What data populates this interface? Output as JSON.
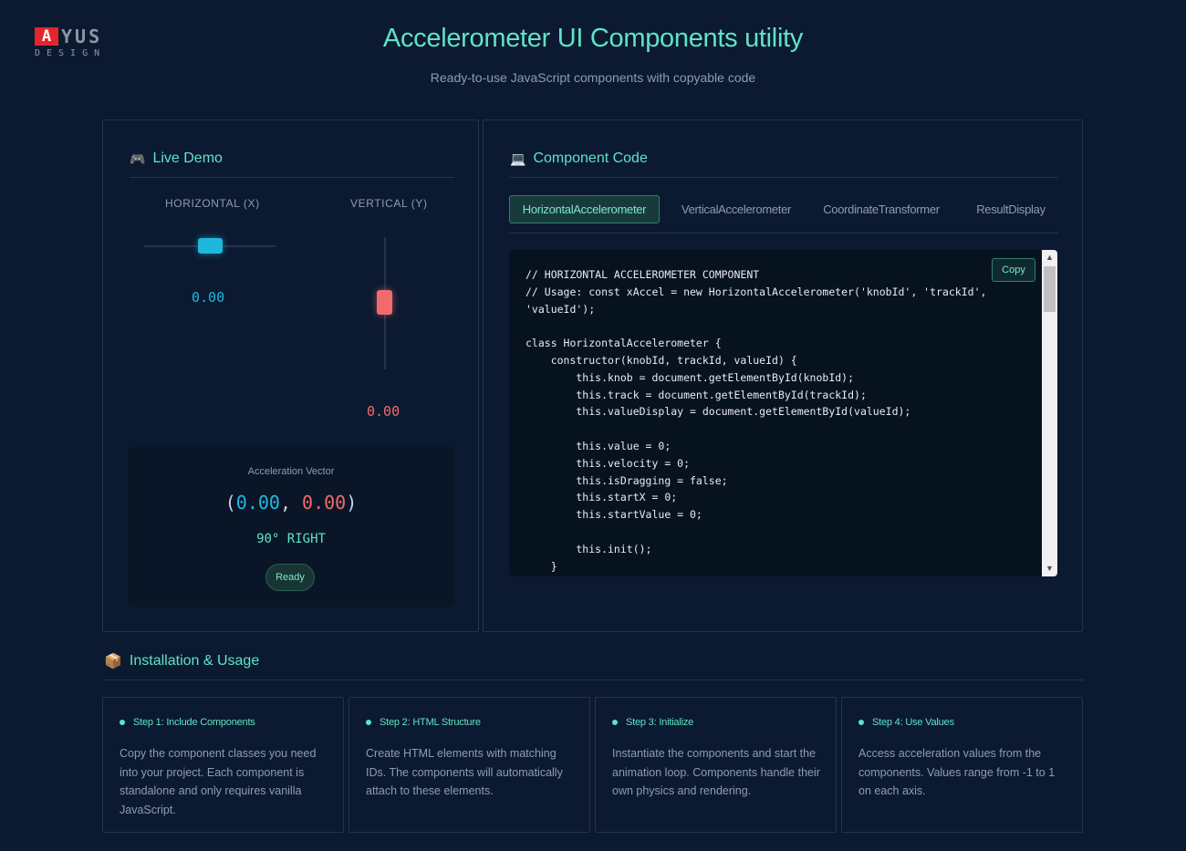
{
  "logo": {
    "mark": "A",
    "rest": "YUS",
    "sub": "DESIGN"
  },
  "header": {
    "title": "Accelerometer UI Components utility",
    "subtitle": "Ready-to-use JavaScript components with copyable code"
  },
  "demo": {
    "icon": "🎮",
    "heading": "Live Demo",
    "horizontal_label": "HORIZONTAL (X)",
    "vertical_label": "VERTICAL (Y)",
    "x_value": "0.00",
    "y_value": "0.00",
    "vector_label": "Acceleration Vector",
    "vector_open": "(",
    "vector_x": "0.00",
    "vector_sep": ", ",
    "vector_y": "0.00",
    "vector_close": ")",
    "direction": "90° RIGHT",
    "status": "Ready"
  },
  "code": {
    "icon": "💻",
    "heading": "Component Code",
    "tabs": [
      {
        "label": "HorizontalAccelerometer",
        "active": true
      },
      {
        "label": "VerticalAccelerometer",
        "active": false
      },
      {
        "label": "CoordinateTransformer",
        "active": false
      },
      {
        "label": "ResultDisplay",
        "active": false
      }
    ],
    "copy_label": "Copy",
    "source": "// HORIZONTAL ACCELEROMETER COMPONENT\n// Usage: const xAccel = new HorizontalAccelerometer('knobId', 'trackId',\n'valueId');\n\nclass HorizontalAccelerometer {\n    constructor(knobId, trackId, valueId) {\n        this.knob = document.getElementById(knobId);\n        this.track = document.getElementById(trackId);\n        this.valueDisplay = document.getElementById(valueId);\n\n        this.value = 0;\n        this.velocity = 0;\n        this.isDragging = false;\n        this.startX = 0;\n        this.startValue = 0;\n\n        this.init();\n    }"
  },
  "install": {
    "icon": "📦",
    "heading": "Installation & Usage",
    "steps": [
      {
        "title": "Step 1: Include Components",
        "desc": "Copy the component classes you need into your project. Each component is standalone and only requires vanilla JavaScript."
      },
      {
        "title": "Step 2: HTML Structure",
        "desc": "Create HTML elements with matching IDs. The components will automatically attach to these elements."
      },
      {
        "title": "Step 3: Initialize",
        "desc": "Instantiate the components and start the animation loop. Components handle their own physics and rendering."
      },
      {
        "title": "Step 4: Use Values",
        "desc": "Access acceleration values from the components. Values range from -1 to 1 on each axis."
      }
    ]
  },
  "colors": {
    "background": "#0c1a31",
    "accent": "#5fe3c6",
    "x_axis": "#22b8e3",
    "y_axis": "#f26b6b",
    "logo_red": "#e3262b"
  }
}
